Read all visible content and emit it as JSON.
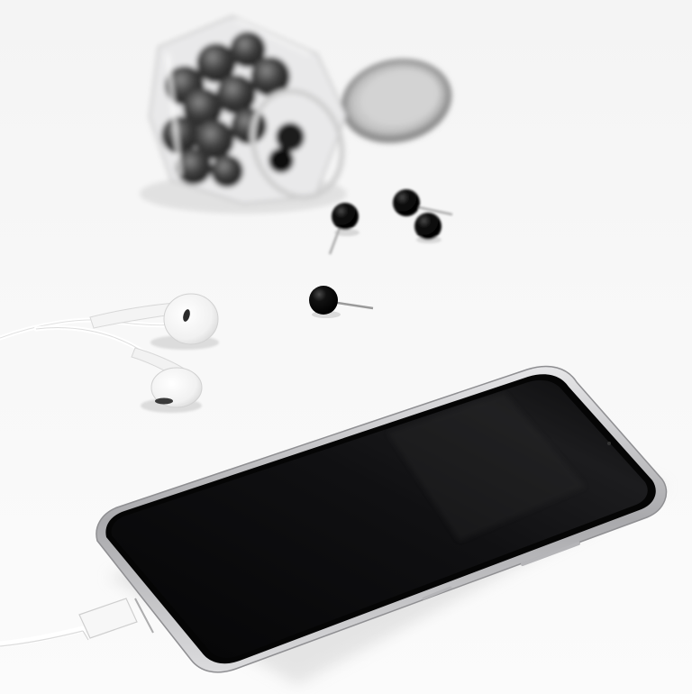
{
  "scene": {
    "objects": [
      "glass-jar-of-black-pushpins",
      "jar-lid",
      "black-pushpin",
      "wired-earphones",
      "smartphone",
      "charging-cable"
    ],
    "colors": {
      "background": "#f6f6f6",
      "phone_screen": "#0b0b0c",
      "phone_frame": "#c9c9cb",
      "pin_head": "#0c0c0c",
      "earphone": "#fbfbfb",
      "cable": "#ffffff"
    }
  }
}
